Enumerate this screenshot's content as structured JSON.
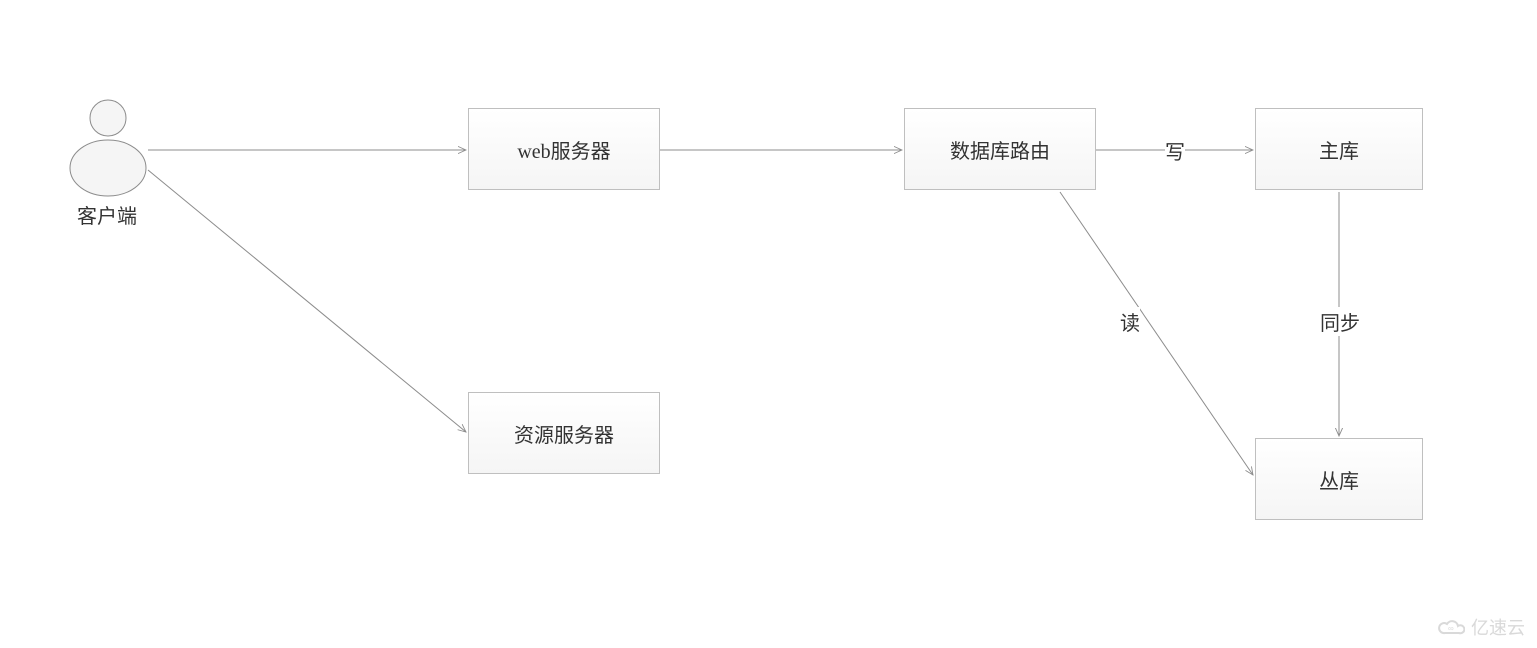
{
  "nodes": {
    "client": {
      "label": "客户端"
    },
    "web": {
      "label": "web服务器"
    },
    "resource": {
      "label": "资源服务器"
    },
    "router": {
      "label": "数据库路由"
    },
    "master": {
      "label": "主库"
    },
    "slave": {
      "label": "丛库"
    }
  },
  "edges": {
    "write": {
      "label": "写"
    },
    "read": {
      "label": "读"
    },
    "sync": {
      "label": "同步"
    }
  },
  "watermark": {
    "text": "亿速云"
  }
}
